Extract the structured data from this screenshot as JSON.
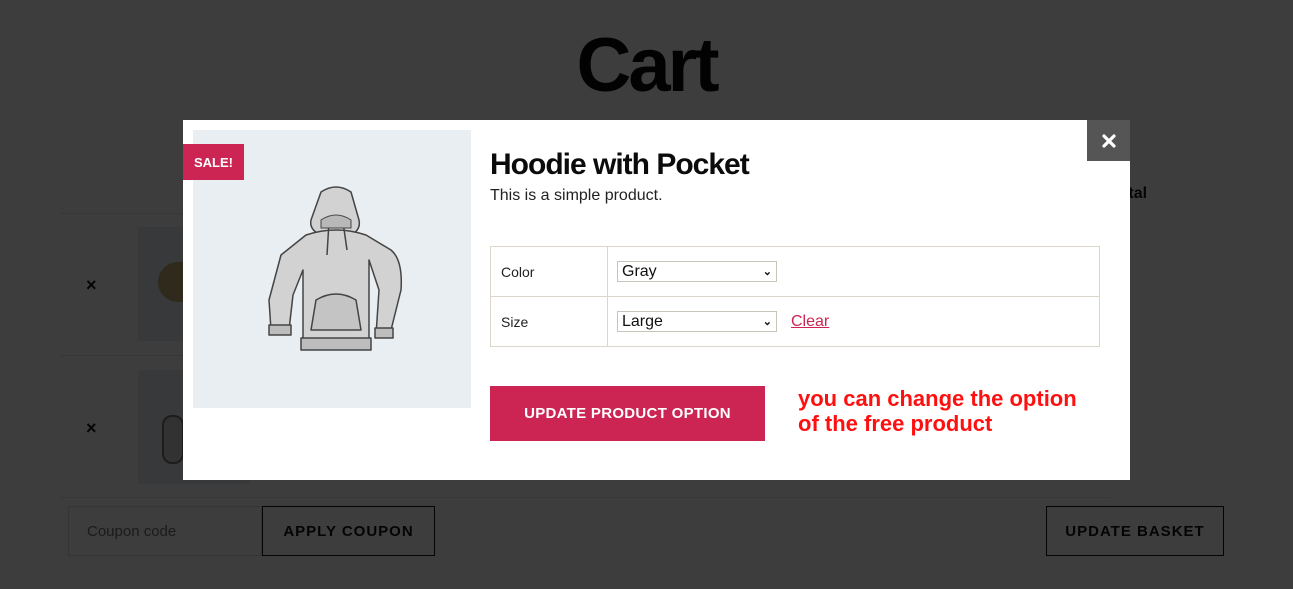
{
  "page": {
    "title": "Cart",
    "column_total_label": "Total",
    "remove_icon_glyph": "×",
    "coupon": {
      "placeholder": "Coupon code",
      "value": ""
    },
    "apply_coupon_label": "APPLY COUPON",
    "update_basket_label": "UPDATE BASKET"
  },
  "modal": {
    "close_glyph": "×",
    "sale_badge": "SALE!",
    "product_title": "Hoodie with Pocket",
    "product_description": "This is a simple product.",
    "variations": [
      {
        "label": "Color",
        "selected": "Gray"
      },
      {
        "label": "Size",
        "selected": "Large"
      }
    ],
    "clear_label": "Clear",
    "update_button_label": "UPDATE PRODUCT OPTION",
    "annotation": [
      "you can change the option",
      "of the free product"
    ]
  },
  "colors": {
    "accent": "#cc2553",
    "overlay": "#3d3d3d",
    "close_button_bg": "#555555",
    "annotation": "#ff1010"
  }
}
